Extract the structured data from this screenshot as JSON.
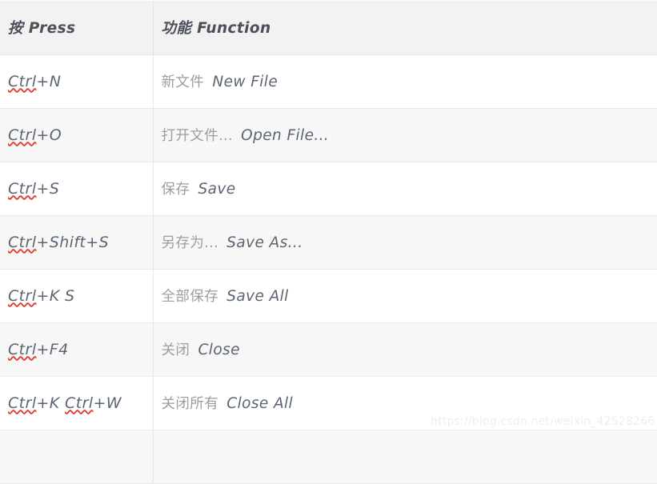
{
  "table": {
    "columns": [
      {
        "key": "press",
        "label_cn": "按",
        "label_en": "Press"
      },
      {
        "key": "function",
        "label_cn": "功能",
        "label_en": "Function"
      }
    ],
    "header": {
      "press": "按  Press",
      "function": "功能  Function"
    },
    "rows": [
      {
        "press": "Ctrl+N",
        "press_prefix": "Ctrl",
        "press_suffix": "+N",
        "function_cn": "新文件",
        "function_en": "New File"
      },
      {
        "press": "Ctrl+O",
        "press_prefix": "Ctrl",
        "press_suffix": "+O",
        "function_cn": "打开文件...",
        "function_en": "Open File..."
      },
      {
        "press": "Ctrl+S",
        "press_prefix": "Ctrl",
        "press_suffix": "+S",
        "function_cn": "保存",
        "function_en": "Save"
      },
      {
        "press": "Ctrl+Shift+S",
        "press_prefix": "Ctrl",
        "press_suffix": "+Shift+S",
        "function_cn": "另存为...",
        "function_en": "Save As..."
      },
      {
        "press": "Ctrl+K S",
        "press_prefix": "Ctrl",
        "press_suffix": "+K S",
        "function_cn": "全部保存",
        "function_en": "Save All"
      },
      {
        "press": "Ctrl+F4",
        "press_prefix": "Ctrl",
        "press_suffix": "+F4",
        "function_cn": "关闭",
        "function_en": "Close"
      },
      {
        "press": "Ctrl+K Ctrl+W",
        "press_prefix": "Ctrl",
        "press_suffix": "+K ",
        "press_prefix2": "Ctrl",
        "press_suffix2": "+W",
        "function_cn": "关闭所有",
        "function_en": "Close All"
      }
    ]
  },
  "watermark": {
    "text": "https://blog.csdn.net/weixin_42528266"
  },
  "colors": {
    "header_bg": "#f2f2f2",
    "row_odd_bg": "#ffffff",
    "row_even_bg": "#f7f7f7",
    "border": "#e6e6e6",
    "key_text": "#5b6573",
    "cn_text": "#9d9d9d",
    "header_text": "#4a4f58",
    "spellcheck_underline": "#e03a2f",
    "watermark_text": "#eeeeee"
  }
}
